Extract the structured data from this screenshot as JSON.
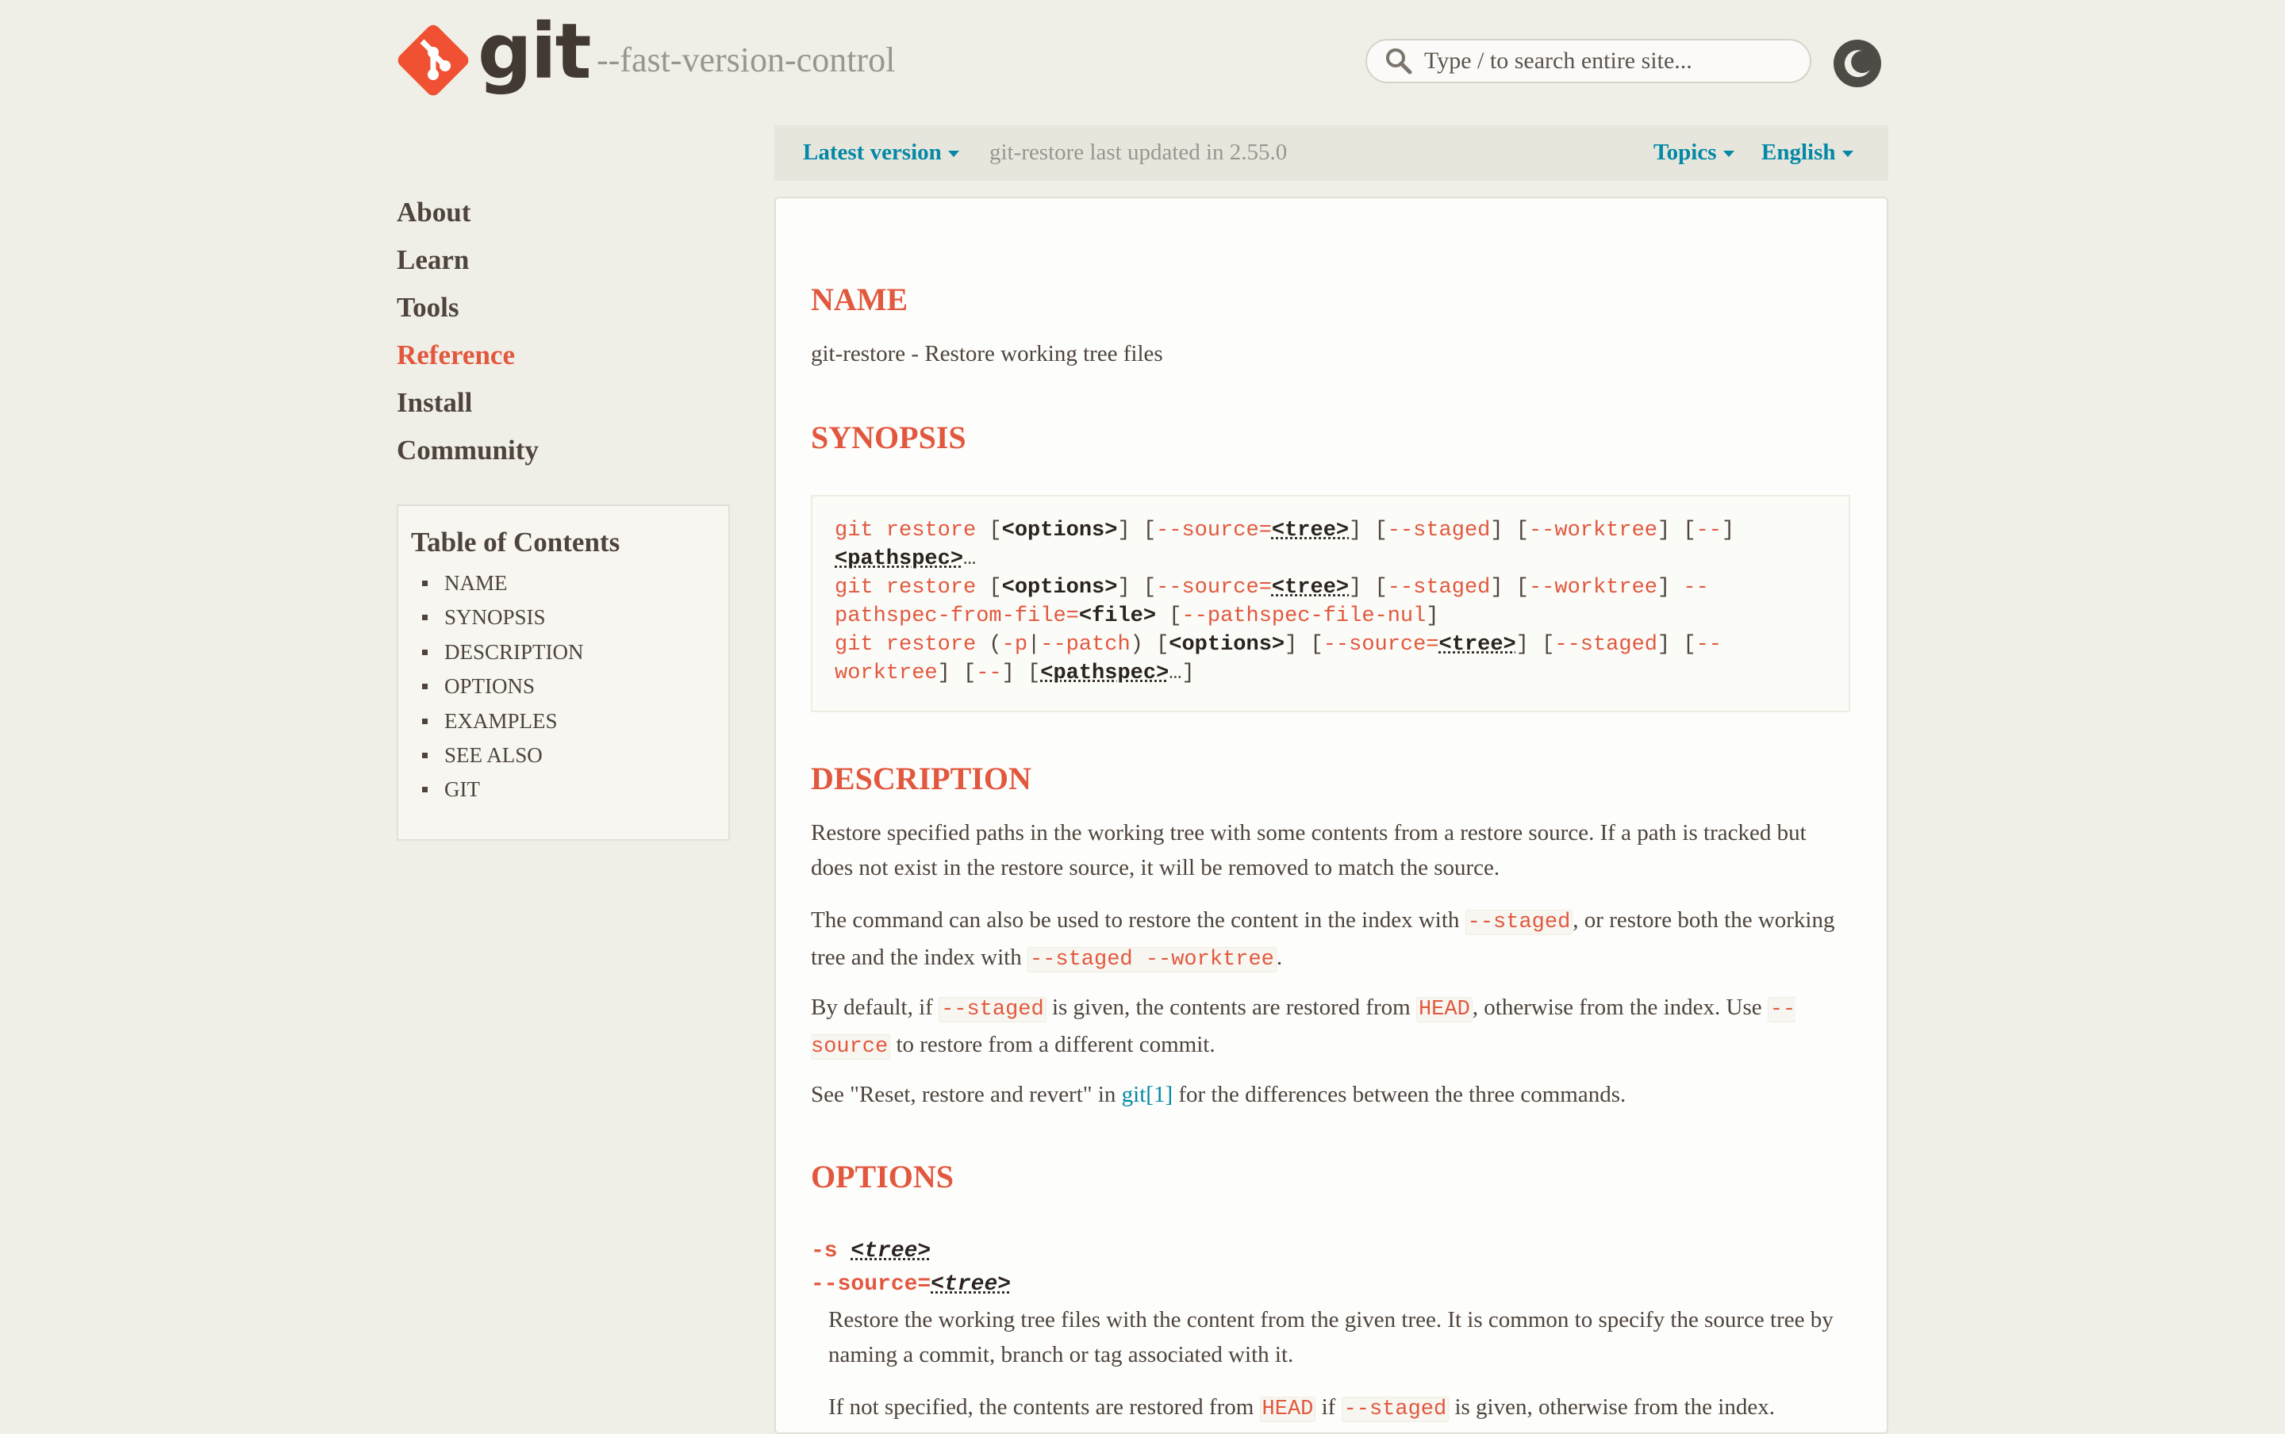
{
  "header": {
    "logo_text": "git",
    "tagline": "--fast-version-control",
    "search_placeholder": "Type / to search entire site..."
  },
  "version_bar": {
    "latest": "Latest version",
    "updated": "git-restore last updated in 2.55.0",
    "topics": "Topics",
    "language": "English"
  },
  "nav": {
    "items": [
      "About",
      "Learn",
      "Tools",
      "Reference",
      "Install",
      "Community"
    ],
    "active": "Reference"
  },
  "toc": {
    "title": "Table of Contents",
    "items": [
      "NAME",
      "SYNOPSIS",
      "DESCRIPTION",
      "OPTIONS",
      "EXAMPLES",
      "SEE ALSO",
      "GIT"
    ]
  },
  "content": {
    "name_heading": "NAME",
    "name_text": "git-restore - Restore working tree files",
    "synopsis_heading": "SYNOPSIS",
    "synopsis_lines": [
      "git restore [<options>] [--source=<tree>] [--staged] [--worktree] [--]",
      "<pathspec>…",
      "git restore [<options>] [--source=<tree>] [--staged] [--worktree] --",
      "pathspec-from-file=<file> [--pathspec-file-nul]",
      "git restore (-p|--patch) [<options>] [--source=<tree>] [--staged] [--",
      "worktree] [--] [<pathspec>…]"
    ],
    "description_heading": "DESCRIPTION",
    "desc_p1": "Restore specified paths in the working tree with some contents from a restore source. If a path is tracked but does not exist in the restore source, it will be removed to match the source.",
    "desc_p2_a": "The command can also be used to restore the content in the index with ",
    "desc_p2_code1": "--staged",
    "desc_p2_b": ", or restore both the working tree and the index with ",
    "desc_p2_code2": "--staged --worktree",
    "desc_p2_c": ".",
    "desc_p3_a": "By default, if ",
    "desc_p3_code1": "--staged",
    "desc_p3_b": " is given, the contents are restored from ",
    "desc_p3_code2": "HEAD",
    "desc_p3_c": ", otherwise from the index. Use ",
    "desc_p3_code3": "--source",
    "desc_p3_d": " to restore from a different commit.",
    "desc_p4_a": "See \"Reset, restore and revert\" in ",
    "desc_p4_link": "git[1]",
    "desc_p4_b": " for the differences between the three commands.",
    "options_heading": "OPTIONS",
    "opt1_short": "-s",
    "opt1_arg": "<tree>",
    "opt1_long": "--source=",
    "opt1_desc": "Restore the working tree files with the content from the given tree. It is common to specify the source tree by naming a commit, branch or tag associated with it.",
    "opt1_desc2_a": "If not specified, the contents are restored from ",
    "opt1_desc2_code1": "HEAD",
    "opt1_desc2_b": " if ",
    "opt1_desc2_code2": "--staged",
    "opt1_desc2_c": " is given, otherwise from the index."
  },
  "colors": {
    "accent": "#e2583e",
    "link": "#0388a6",
    "background": "#f0efe7",
    "text": "#4e443c"
  },
  "icons": [
    "git-logo-icon",
    "search-icon",
    "moon-icon",
    "chevron-down-icon"
  ]
}
